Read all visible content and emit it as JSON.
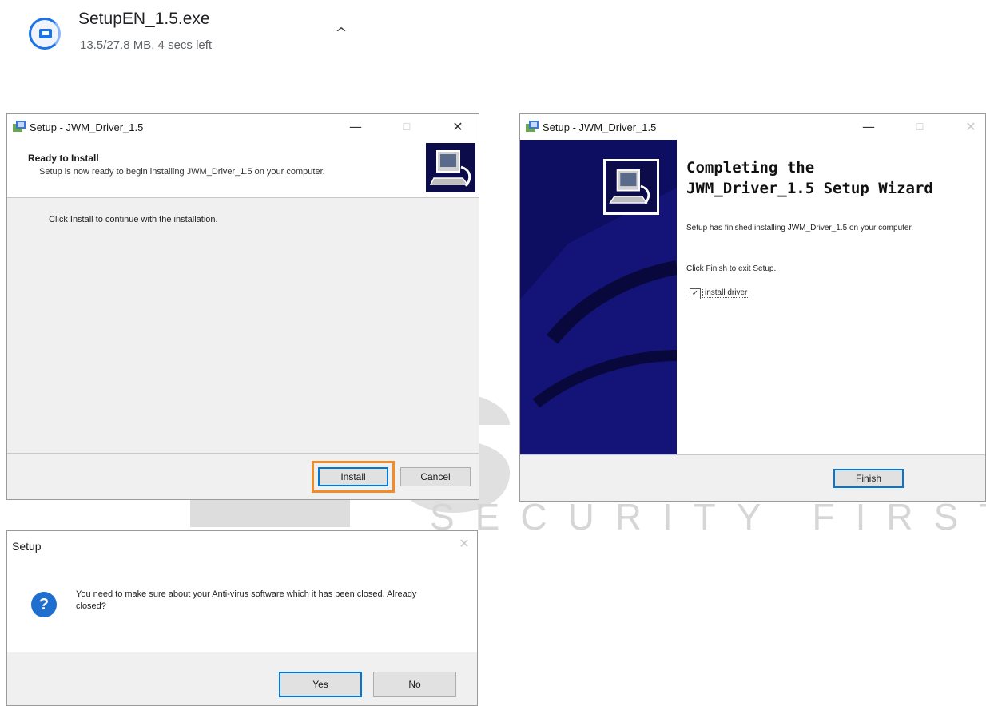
{
  "download": {
    "filename": "SetupEN_1.5.exe",
    "status": "13.5/27.8 MB, 4 secs left",
    "icon": "installer-file-icon",
    "chevron_icon": "chevron-up-icon",
    "chevron_glyph": "^"
  },
  "watermark": {
    "text": "SECURITY FIRST"
  },
  "window_ready": {
    "title": "Setup - JWM_Driver_1.5",
    "minimize_glyph": "—",
    "maximize_glyph": "☐",
    "close_glyph": "✕",
    "header_title": "Ready to Install",
    "header_subtitle": "Setup is now ready to begin installing JWM_Driver_1.5 on your computer.",
    "body_text": "Click Install to continue with the installation.",
    "install_label": "Install",
    "cancel_label": "Cancel",
    "highlight_color": "#f28c28"
  },
  "window_complete": {
    "title": "Setup - JWM_Driver_1.5",
    "minimize_glyph": "—",
    "maximize_glyph": "☐",
    "close_glyph": "✕",
    "heading_line1": "Completing the",
    "heading_line2": "JWM_Driver_1.5 Setup Wizard",
    "finished_text": "Setup has finished installing JWM_Driver_1.5 on your computer.",
    "exit_text": "Click Finish to exit Setup.",
    "checkbox_label": "install driver",
    "checkbox_checked": true,
    "checkbox_glyph": "✓",
    "finish_label": "Finish",
    "sidebar_color": "#0d0d62"
  },
  "window_prompt": {
    "title": "Setup",
    "close_glyph": "✕",
    "question_glyph": "?",
    "message": "You need to make sure about your Anti-virus software which it has been closed. Already closed?",
    "yes_label": "Yes",
    "no_label": "No"
  }
}
